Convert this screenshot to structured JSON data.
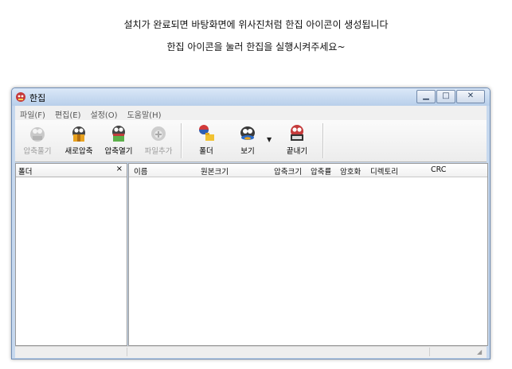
{
  "captions": {
    "line1": "설치가 완료되면 바탕화면에 위사진처럼 한집 아이콘이 생성됩니다",
    "line2": "한집 아이콘을 눌러 한집을 실행시켜주세요~"
  },
  "window": {
    "title": "한집"
  },
  "menu": [
    {
      "label": "파일(F)"
    },
    {
      "label": "편집(E)"
    },
    {
      "label": "설정(O)"
    },
    {
      "label": "도움말(H)"
    }
  ],
  "toolbar": {
    "extract": "압축풀기",
    "new": "새로압축",
    "open": "압축열기",
    "add": "파일추가",
    "folder": "폴더",
    "view": "보기",
    "exit": "끝내기"
  },
  "folder_panel": {
    "title": "폴더",
    "close": "×"
  },
  "columns": [
    "이름",
    "원본크기",
    "압축크기",
    "압축률",
    "암호화",
    "디렉토리",
    "CRC"
  ]
}
